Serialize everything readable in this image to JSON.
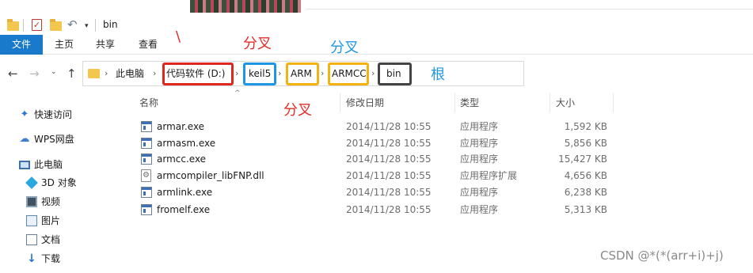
{
  "window": {
    "title": "bin"
  },
  "ribbon": {
    "tabs": [
      "文件",
      "主页",
      "共享",
      "查看"
    ]
  },
  "address": {
    "crumbs": [
      "此电脑",
      "代码软件 (D:)",
      "keil5",
      "ARM",
      "ARMCC",
      "bin"
    ],
    "chevron": "›"
  },
  "annotations": {
    "slash": "\\",
    "fork_red_top": "分叉",
    "fork_blue": "分叉",
    "fork_red_bottom": "分叉",
    "root": "根"
  },
  "sidebar": {
    "items": [
      {
        "label": "快速访问",
        "icon": "pin-icon"
      },
      {
        "label": "WPS网盘",
        "icon": "cloud-icon"
      },
      {
        "label": "此电脑",
        "icon": "computer-icon"
      },
      {
        "label": "3D 对象",
        "icon": "3d-objects-icon"
      },
      {
        "label": "视频",
        "icon": "video-icon"
      },
      {
        "label": "图片",
        "icon": "picture-icon"
      },
      {
        "label": "文档",
        "icon": "document-icon"
      },
      {
        "label": "下载",
        "icon": "download-icon"
      }
    ]
  },
  "columns": {
    "name": "名称",
    "date": "修改日期",
    "type": "类型",
    "size": "大小"
  },
  "files": [
    {
      "name": "armar.exe",
      "date": "2014/11/28 10:55",
      "type": "应用程序",
      "size": "1,592 KB",
      "icon": "exe-icon"
    },
    {
      "name": "armasm.exe",
      "date": "2014/11/28 10:55",
      "type": "应用程序",
      "size": "5,856 KB",
      "icon": "exe-icon"
    },
    {
      "name": "armcc.exe",
      "date": "2014/11/28 10:55",
      "type": "应用程序",
      "size": "15,427 KB",
      "icon": "exe-icon"
    },
    {
      "name": "armcompiler_libFNP.dll",
      "date": "2014/11/28 10:55",
      "type": "应用程序扩展",
      "size": "4,656 KB",
      "icon": "dll-icon"
    },
    {
      "name": "armlink.exe",
      "date": "2014/11/28 10:55",
      "type": "应用程序",
      "size": "6,238 KB",
      "icon": "exe-icon"
    },
    {
      "name": "fromelf.exe",
      "date": "2014/11/28 10:55",
      "type": "应用程序",
      "size": "5,313 KB",
      "icon": "exe-icon"
    }
  ],
  "watermark": "CSDN @*(*(arr+i)+j)"
}
